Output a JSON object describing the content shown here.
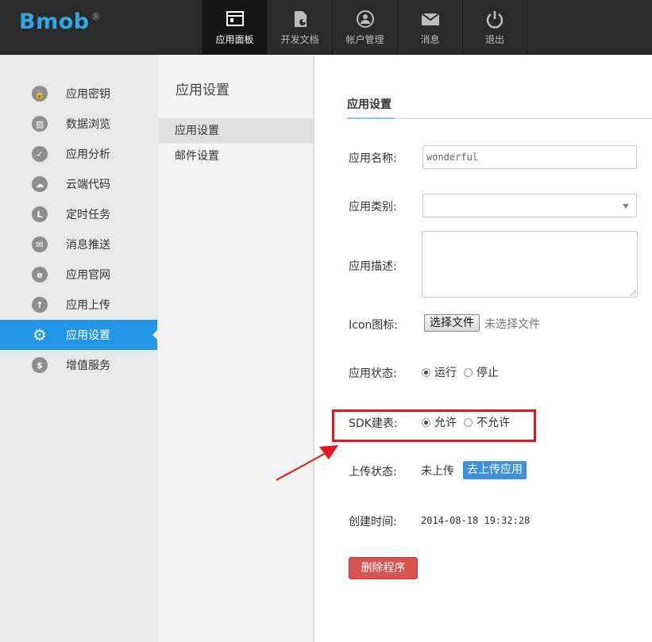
{
  "logo": {
    "text": "Bmob",
    "mark": "®"
  },
  "nav": [
    {
      "label": "应用面板",
      "icon": "dashboard-icon",
      "active": true
    },
    {
      "label": "开发文档",
      "icon": "document-icon",
      "active": false
    },
    {
      "label": "帐户管理",
      "icon": "account-icon",
      "active": false
    },
    {
      "label": "消息",
      "icon": "mail-icon",
      "active": false
    },
    {
      "label": "退出",
      "icon": "power-icon",
      "active": false
    }
  ],
  "sidebar": {
    "items": [
      {
        "label": "应用密钥",
        "icon": "lock-icon"
      },
      {
        "label": "数据浏览",
        "icon": "chart-icon"
      },
      {
        "label": "应用分析",
        "icon": "check-icon"
      },
      {
        "label": "云端代码",
        "icon": "cloud-icon"
      },
      {
        "label": "定时任务",
        "icon": "clock-icon"
      },
      {
        "label": "消息推送",
        "icon": "envelope-icon"
      },
      {
        "label": "应用官网",
        "icon": "browser-icon"
      },
      {
        "label": "应用上传",
        "icon": "upload-icon"
      },
      {
        "label": "应用设置",
        "icon": "gear-icon",
        "active": true
      },
      {
        "label": "增值服务",
        "icon": "dollar-icon"
      }
    ]
  },
  "subnav": {
    "title": "应用设置",
    "items": [
      {
        "label": "应用设置",
        "active": true
      },
      {
        "label": "邮件设置",
        "active": false
      }
    ]
  },
  "main": {
    "tab": "应用设置",
    "app_name_label": "应用名称:",
    "app_name_value": "wonderful",
    "app_type_label": "应用类别:",
    "app_type_value": "",
    "app_desc_label": "应用描述:",
    "app_desc_value": "",
    "icon_label": "Icon图标:",
    "file_button": "选择文件",
    "file_status": "未选择文件",
    "state_label": "应用状态:",
    "state_options": [
      "运行",
      "停止"
    ],
    "state_selected": "运行",
    "sdk_label": "SDK建表:",
    "sdk_options": [
      "允许",
      "不允许"
    ],
    "sdk_selected": "允许",
    "upload_label": "上传状态:",
    "upload_status": "未上传",
    "upload_button": "去上传应用",
    "created_label": "创建时间:",
    "created_value": "2014-08-18 19:32:28",
    "delete_button": "删除程序"
  },
  "colors": {
    "topbar": "#2b2b2b",
    "accent": "#2196e6",
    "danger": "#d9534f",
    "annotation": "#e8131b"
  }
}
